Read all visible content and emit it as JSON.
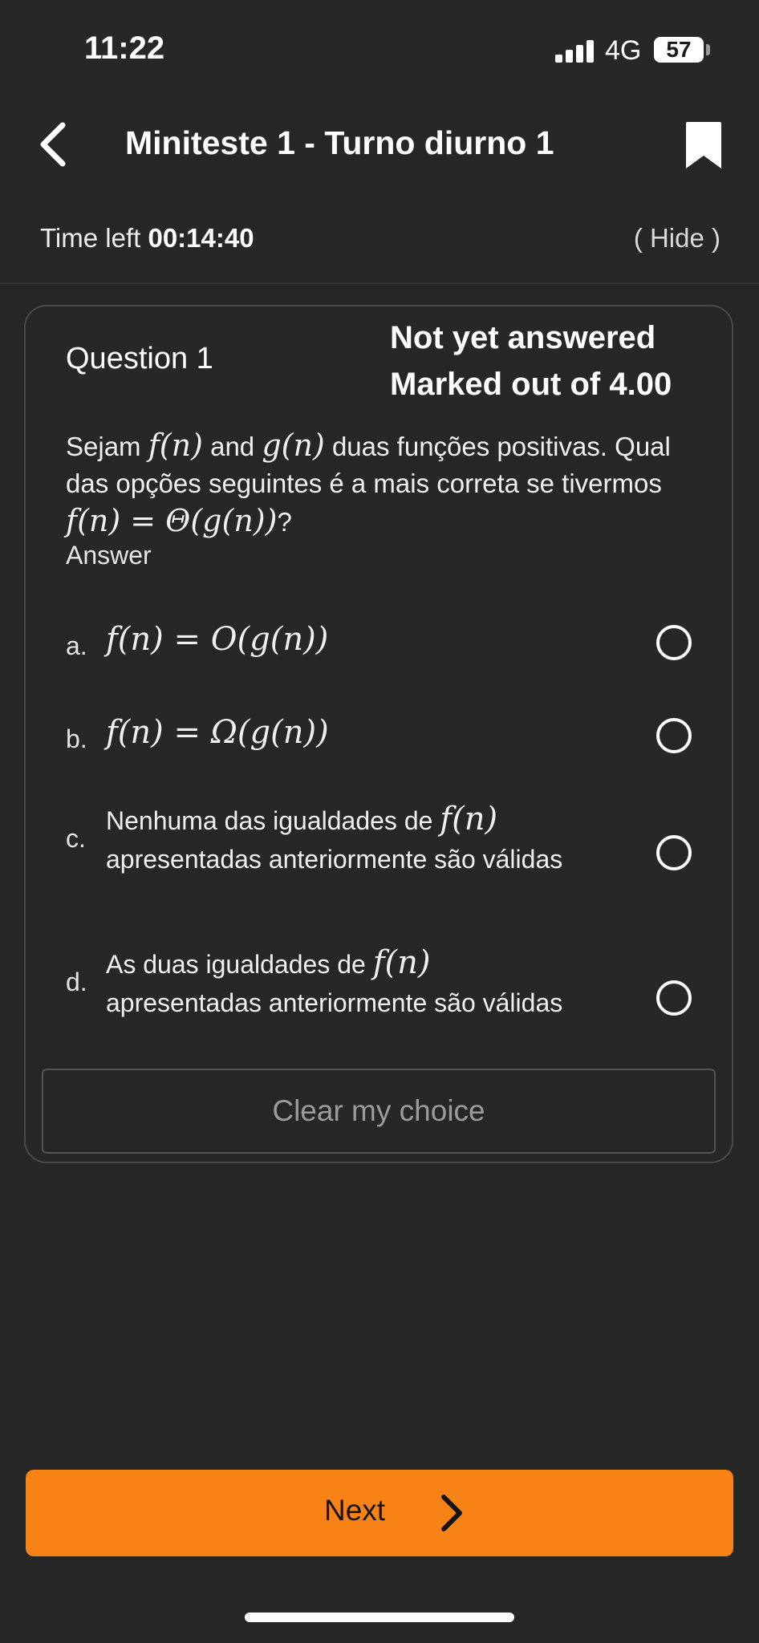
{
  "status_bar": {
    "time": "11:22",
    "network": "4G",
    "battery": "57"
  },
  "header": {
    "title": "Miniteste 1 - Turno diurno 1",
    "back_icon": "chevron-left-icon",
    "bookmark_icon": "bookmark-icon"
  },
  "timer": {
    "label": "Time left",
    "value": "00:14:40",
    "hide_label": "( Hide )"
  },
  "question": {
    "number_label": "Question 1",
    "state": "Not yet answered",
    "mark": "Marked out of 4.00",
    "text_1": "Sejam",
    "f_n": "f(n)",
    "text_and": "and",
    "g_n": "g(n)",
    "text_2": "duas funções positivas. Qual das opções seguintes é a mais correta se tivermos",
    "condition": "f(n) = Θ(g(n))",
    "text_end": "?",
    "answer_label": "Answer"
  },
  "options": [
    {
      "letter": "a.",
      "math": "f(n) = O(g(n))",
      "selected": false
    },
    {
      "letter": "b.",
      "math": "f(n) = Ω(g(n))",
      "selected": false
    },
    {
      "letter": "c.",
      "text_pre": "Nenhuma das igualdades de",
      "math": "f(n)",
      "text_post": "apresentadas anteriormente são válidas",
      "selected": false
    },
    {
      "letter": "d.",
      "text_pre": "As duas igualdades de",
      "math": "f(n)",
      "text_post": "apresentadas anteriormente são válidas",
      "selected": false
    }
  ],
  "clear_label": "Clear my choice",
  "next_label": "Next",
  "colors": {
    "background": "#272727",
    "accent": "#f78316"
  }
}
